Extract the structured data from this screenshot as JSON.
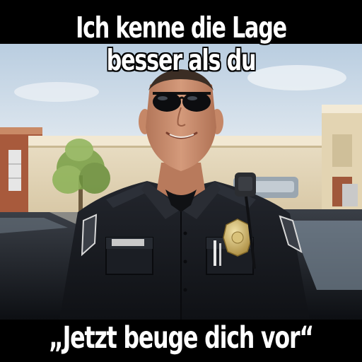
{
  "meme": {
    "top_line_1": "Ich kenne die Lage",
    "top_line_2": "besser als du",
    "bottom_text": "„Jetzt beuge dich vor“"
  },
  "colors": {
    "caption_text": "#ffffff",
    "caption_outline": "#000000",
    "sky": "#c9d8e6",
    "building": "#e7d9bd",
    "uniform": "#1a1c22",
    "badge": "#c9b06a"
  }
}
